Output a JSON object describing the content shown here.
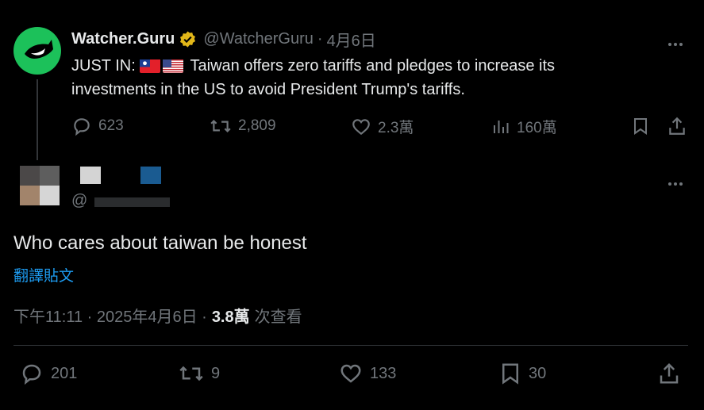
{
  "parent_tweet": {
    "display_name": "Watcher.Guru",
    "handle": "@WatcherGuru",
    "separator": "·",
    "date": "4月6日",
    "text_prefix": "JUST IN:",
    "text_line1": "Taiwan offers zero tariffs and pledges to increase its",
    "text_line2": "investments in the US to avoid President Trump's tariffs.",
    "stats": {
      "replies": "623",
      "retweets": "2,809",
      "likes": "2.3萬",
      "views": "160萬"
    },
    "colors": {
      "avatar_bg": "#1cc15a",
      "verified": "#e2b719"
    }
  },
  "reply_tweet": {
    "handle_prefix": "@",
    "text": "Who cares about taiwan be honest",
    "translate_link": "翻譯貼文",
    "timestamp": "下午11:11 · 2025年4月6日 ·",
    "views_count": "3.8萬",
    "views_label": "次查看",
    "stats": {
      "replies": "201",
      "retweets": "9",
      "likes": "133",
      "bookmarks": "30"
    }
  },
  "colors": {
    "background": "#000000",
    "text": "#e7e9ea",
    "muted": "#71767b",
    "link": "#1d9bf0",
    "divider": "#2f3336"
  }
}
